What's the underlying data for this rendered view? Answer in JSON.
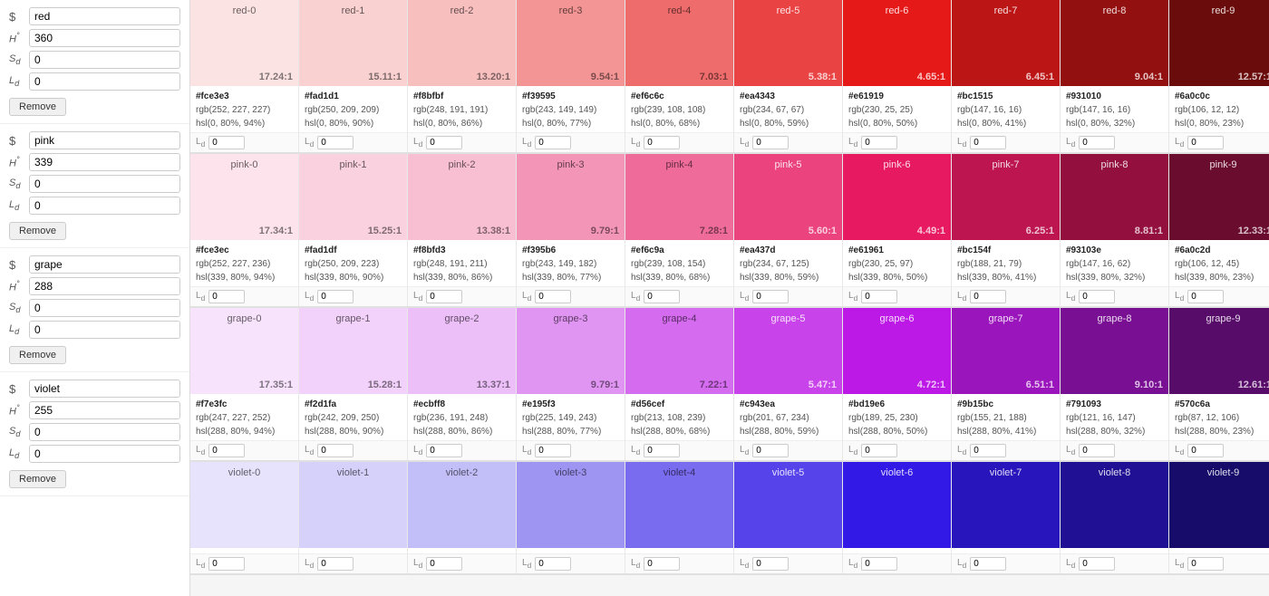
{
  "controls": [
    {
      "id": "red",
      "name": "red",
      "h": "360",
      "s": "0",
      "l": "0"
    },
    {
      "id": "pink",
      "name": "pink",
      "h": "339",
      "s": "0",
      "l": "0"
    },
    {
      "id": "grape",
      "name": "grape",
      "h": "288",
      "s": "0",
      "l": "0"
    },
    {
      "id": "violet",
      "name": "violet",
      "h": "255",
      "s": "0",
      "l": "0"
    }
  ],
  "swatches": [
    {
      "groupName": "red",
      "items": [
        {
          "name": "red-0",
          "bg": "#fce3e3",
          "ratio": "17.24:1",
          "hex": "#fce3e3",
          "rgb": "rgb(252, 227, 227)",
          "hsl": "hsl(0, 80%, 94%)"
        },
        {
          "name": "red-1",
          "bg": "#fad1d1",
          "ratio": "15.11:1",
          "hex": "#fad1d1",
          "rgb": "rgb(250, 209, 209)",
          "hsl": "hsl(0, 80%, 90%)"
        },
        {
          "name": "red-2",
          "bg": "#f8bfbf",
          "ratio": "13.20:1",
          "hex": "#f8bfbf",
          "rgb": "rgb(248, 191, 191)",
          "hsl": "hsl(0, 80%, 86%)"
        },
        {
          "name": "red-3",
          "bg": "#f39595",
          "ratio": "9.54:1",
          "hex": "#f39595",
          "rgb": "rgb(243, 149, 149)",
          "hsl": "hsl(0, 80%, 77%)"
        },
        {
          "name": "red-4",
          "bg": "#ef6c6c",
          "ratio": "7.03:1",
          "hex": "#ef6c6c",
          "rgb": "rgb(239, 108, 108)",
          "hsl": "hsl(0, 80%, 68%)"
        },
        {
          "name": "red-5",
          "bg": "#ea4343",
          "ratio": "5.38:1",
          "hex": "#ea4343",
          "rgb": "rgb(234, 67, 67)",
          "hsl": "hsl(0, 80%, 59%)"
        },
        {
          "name": "red-6",
          "bg": "#e61919",
          "ratio": "4.65:1",
          "hex": "#e61919",
          "rgb": "rgb(230, 25, 25)",
          "hsl": "hsl(0, 80%, 50%)"
        },
        {
          "name": "red-7",
          "bg": "#bc1515",
          "ratio": "6.45:1",
          "hex": "#bc1515",
          "rgb": "rgb(147, 16, 16)",
          "hsl": "hsl(0, 80%, 41%)"
        },
        {
          "name": "red-8",
          "bg": "#931010",
          "ratio": "9.04:1",
          "hex": "#931010",
          "rgb": "rgb(147, 16, 16)",
          "hsl": "hsl(0, 80%, 32%)"
        },
        {
          "name": "red-9",
          "bg": "#6a0c0c",
          "ratio": "12.57:1",
          "hex": "#6a0c0c",
          "rgb": "rgb(106, 12, 12)",
          "hsl": "hsl(0, 80%, 23%)"
        }
      ]
    },
    {
      "groupName": "pink",
      "items": [
        {
          "name": "pink-0",
          "bg": "#fce3ec",
          "ratio": "17.34:1",
          "hex": "#fce3ec",
          "rgb": "rgb(252, 227, 236)",
          "hsl": "hsl(339, 80%, 94%)"
        },
        {
          "name": "pink-1",
          "bg": "#fad1df",
          "ratio": "15.25:1",
          "hex": "#fad1df",
          "rgb": "rgb(250, 209, 223)",
          "hsl": "hsl(339, 80%, 90%)"
        },
        {
          "name": "pink-2",
          "bg": "#f8bfd3",
          "ratio": "13.38:1",
          "hex": "#f8bfd3",
          "rgb": "rgb(248, 191, 211)",
          "hsl": "hsl(339, 80%, 86%)"
        },
        {
          "name": "pink-3",
          "bg": "#f395b6",
          "ratio": "9.79:1",
          "hex": "#f395b6",
          "rgb": "rgb(243, 149, 182)",
          "hsl": "hsl(339, 80%, 77%)"
        },
        {
          "name": "pink-4",
          "bg": "#ef6c9a",
          "ratio": "7.28:1",
          "hex": "#ef6c9a",
          "rgb": "rgb(239, 108, 154)",
          "hsl": "hsl(339, 80%, 68%)"
        },
        {
          "name": "pink-5",
          "bg": "#ea437d",
          "ratio": "5.60:1",
          "hex": "#ea437d",
          "rgb": "rgb(234, 67, 125)",
          "hsl": "hsl(339, 80%, 59%)"
        },
        {
          "name": "pink-6",
          "bg": "#e61961",
          "ratio": "4.49:1",
          "hex": "#e61961",
          "rgb": "rgb(230, 25, 97)",
          "hsl": "hsl(339, 80%, 50%)"
        },
        {
          "name": "pink-7",
          "bg": "#bc154f",
          "ratio": "6.25:1",
          "hex": "#bc154f",
          "rgb": "rgb(188, 21, 79)",
          "hsl": "hsl(339, 80%, 41%)"
        },
        {
          "name": "pink-8",
          "bg": "#93103e",
          "ratio": "8.81:1",
          "hex": "#93103e",
          "rgb": "rgb(147, 16, 62)",
          "hsl": "hsl(339, 80%, 32%)"
        },
        {
          "name": "pink-9",
          "bg": "#6a0c2d",
          "ratio": "12.33:1",
          "hex": "#6a0c2d",
          "rgb": "rgb(106, 12, 45)",
          "hsl": "hsl(339, 80%, 23%)"
        }
      ]
    },
    {
      "groupName": "grape",
      "items": [
        {
          "name": "grape-0",
          "bg": "#f7e3fc",
          "ratio": "17.35:1",
          "hex": "#f7e3fc",
          "rgb": "rgb(247, 227, 252)",
          "hsl": "hsl(288, 80%, 94%)"
        },
        {
          "name": "grape-1",
          "bg": "#f2d1fa",
          "ratio": "15.28:1",
          "hex": "#f2d1fa",
          "rgb": "rgb(242, 209, 250)",
          "hsl": "hsl(288, 80%, 90%)"
        },
        {
          "name": "grape-2",
          "bg": "#ecbff8",
          "ratio": "13.37:1",
          "hex": "#ecbff8",
          "rgb": "rgb(236, 191, 248)",
          "hsl": "hsl(288, 80%, 86%)"
        },
        {
          "name": "grape-3",
          "bg": "#e195f3",
          "ratio": "9.79:1",
          "hex": "#e195f3",
          "rgb": "rgb(225, 149, 243)",
          "hsl": "hsl(288, 80%, 77%)"
        },
        {
          "name": "grape-4",
          "bg": "#d56cef",
          "ratio": "7.22:1",
          "hex": "#d56cef",
          "rgb": "rgb(213, 108, 239)",
          "hsl": "hsl(288, 80%, 68%)"
        },
        {
          "name": "grape-5",
          "bg": "#c943ea",
          "ratio": "5.47:1",
          "hex": "#c943ea",
          "rgb": "rgb(201, 67, 234)",
          "hsl": "hsl(288, 80%, 59%)"
        },
        {
          "name": "grape-6",
          "bg": "#bd19e6",
          "ratio": "4.72:1",
          "hex": "#bd19e6",
          "rgb": "rgb(189, 25, 230)",
          "hsl": "hsl(288, 80%, 50%)"
        },
        {
          "name": "grape-7",
          "bg": "#9b15bc",
          "ratio": "6.51:1",
          "hex": "#9b15bc",
          "rgb": "rgb(155, 21, 188)",
          "hsl": "hsl(288, 80%, 41%)"
        },
        {
          "name": "grape-8",
          "bg": "#791093",
          "ratio": "9.10:1",
          "hex": "#791093",
          "rgb": "rgb(121, 16, 147)",
          "hsl": "hsl(288, 80%, 32%)"
        },
        {
          "name": "grape-9",
          "bg": "#570c6a",
          "ratio": "12.61:1",
          "hex": "#570c6a",
          "rgb": "rgb(87, 12, 106)",
          "hsl": "hsl(288, 80%, 23%)"
        }
      ]
    },
    {
      "groupName": "violet",
      "items": [
        {
          "name": "violet-0",
          "bg": "#e8e3fc",
          "ratio": "",
          "hex": "",
          "rgb": "",
          "hsl": ""
        },
        {
          "name": "violet-1",
          "bg": "#d5d1fa",
          "ratio": "",
          "hex": "",
          "rgb": "",
          "hsl": ""
        },
        {
          "name": "violet-2",
          "bg": "#c2bff8",
          "ratio": "",
          "hex": "",
          "rgb": "",
          "hsl": ""
        },
        {
          "name": "violet-3",
          "bg": "#9e95f3",
          "ratio": "",
          "hex": "",
          "rgb": "",
          "hsl": ""
        },
        {
          "name": "violet-4",
          "bg": "#7a6cef",
          "ratio": "",
          "hex": "",
          "rgb": "",
          "hsl": ""
        },
        {
          "name": "violet-5",
          "bg": "#5643ea",
          "ratio": "",
          "hex": "",
          "rgb": "",
          "hsl": ""
        },
        {
          "name": "violet-6",
          "bg": "#3219e6",
          "ratio": "",
          "hex": "",
          "rgb": "",
          "hsl": ""
        },
        {
          "name": "violet-7",
          "bg": "#2915bc",
          "ratio": "",
          "hex": "",
          "rgb": "",
          "hsl": ""
        },
        {
          "name": "violet-8",
          "bg": "#201093",
          "ratio": "",
          "hex": "",
          "rgb": "",
          "hsl": ""
        },
        {
          "name": "violet-9",
          "bg": "#170c6a",
          "ratio": "",
          "hex": "",
          "rgb": "",
          "hsl": ""
        }
      ]
    }
  ],
  "labels": {
    "dollar": "$",
    "h_label": "H",
    "s_label": "S",
    "l_label": "L",
    "ld_label": "L",
    "remove": "Remove",
    "zero": "0"
  }
}
